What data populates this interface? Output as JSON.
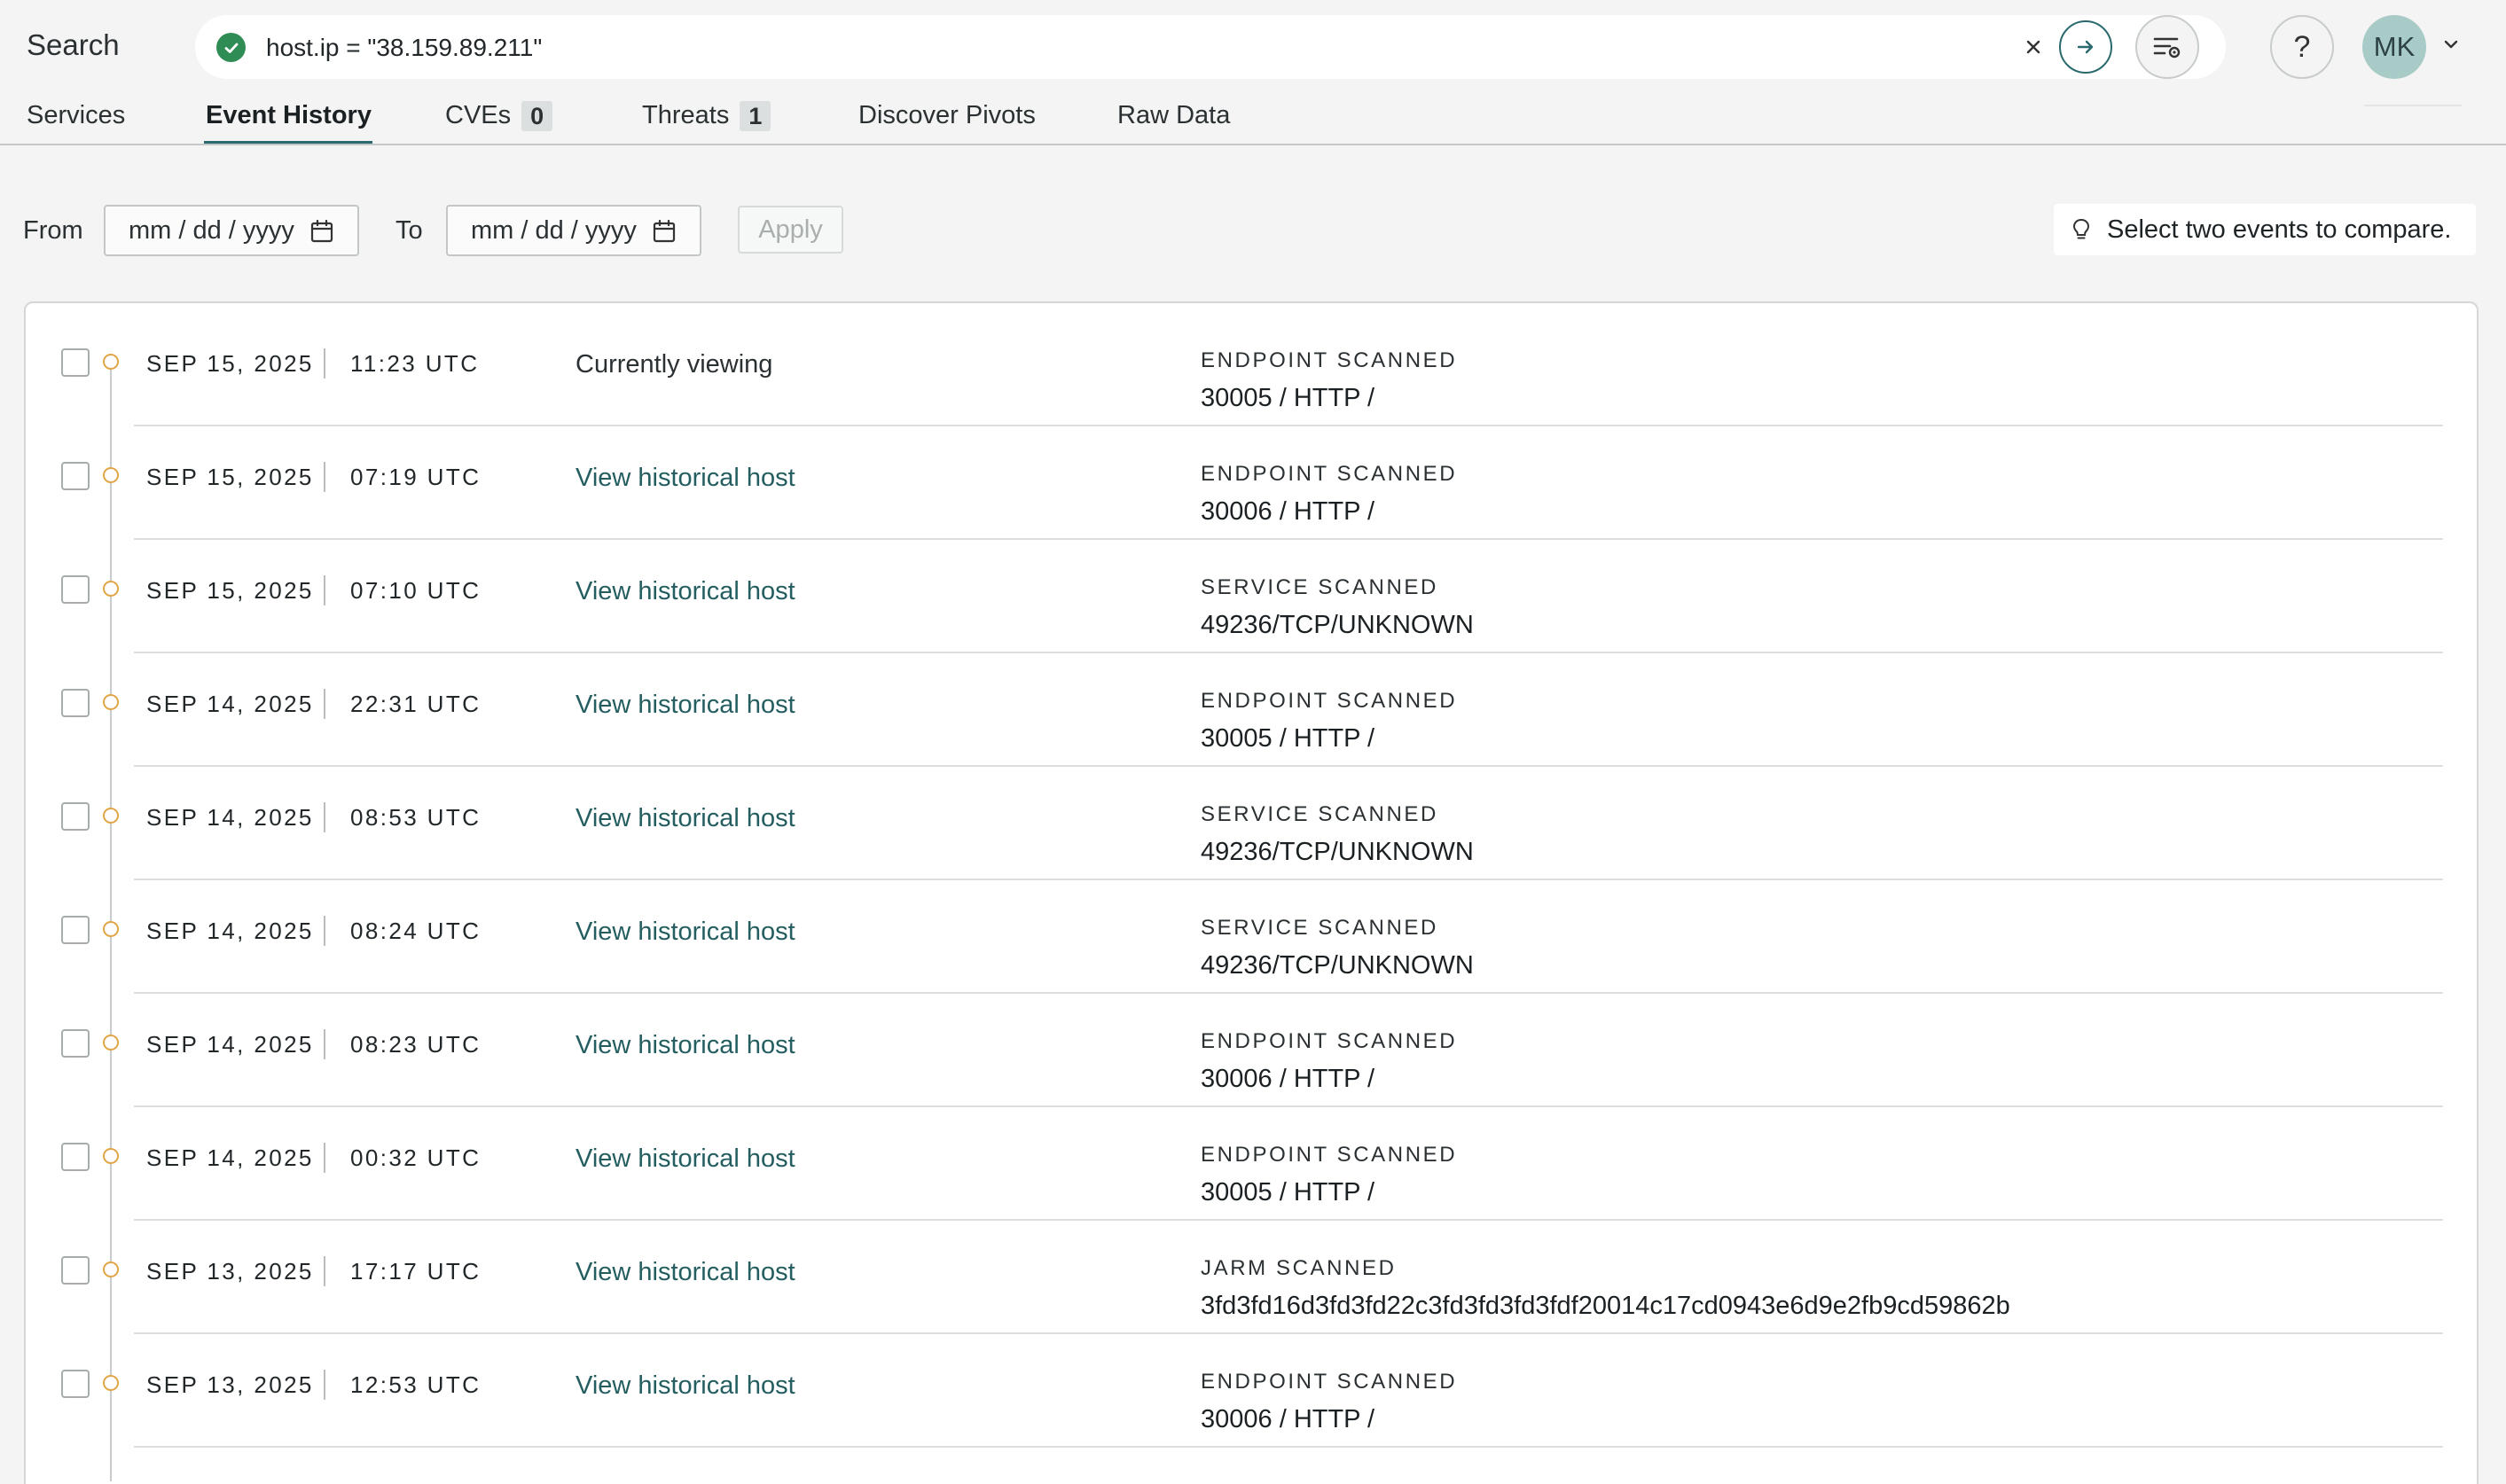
{
  "header": {
    "search_label": "Search",
    "query": "host.ip = \"38.159.89.211\"",
    "avatar_initials": "MK",
    "help_label": "?"
  },
  "tabs": [
    {
      "label": "Services",
      "badge": null
    },
    {
      "label": "Event History",
      "badge": null,
      "active": true
    },
    {
      "label": "CVEs",
      "badge": "0"
    },
    {
      "label": "Threats",
      "badge": "1"
    },
    {
      "label": "Discover Pivots",
      "badge": null
    },
    {
      "label": "Raw Data",
      "badge": null
    }
  ],
  "filters": {
    "from_label": "From",
    "to_label": "To",
    "from_placeholder": "mm / dd / yyyy",
    "to_placeholder": "mm / dd / yyyy",
    "apply_label": "Apply",
    "compare_hint": "Select two events to compare."
  },
  "events": [
    {
      "date": "SEP 15, 2025",
      "time": "11:23 UTC",
      "link": "Currently viewing",
      "current": true,
      "type": "ENDPOINT SCANNED",
      "value": "30005 / HTTP /"
    },
    {
      "date": "SEP 15, 2025",
      "time": "07:19 UTC",
      "link": "View historical host",
      "current": false,
      "type": "ENDPOINT SCANNED",
      "value": "30006 / HTTP /"
    },
    {
      "date": "SEP 15, 2025",
      "time": "07:10 UTC",
      "link": "View historical host",
      "current": false,
      "type": "SERVICE SCANNED",
      "value": "49236/TCP/UNKNOWN"
    },
    {
      "date": "SEP 14, 2025",
      "time": "22:31 UTC",
      "link": "View historical host",
      "current": false,
      "type": "ENDPOINT SCANNED",
      "value": "30005 / HTTP /"
    },
    {
      "date": "SEP 14, 2025",
      "time": "08:53 UTC",
      "link": "View historical host",
      "current": false,
      "type": "SERVICE SCANNED",
      "value": "49236/TCP/UNKNOWN"
    },
    {
      "date": "SEP 14, 2025",
      "time": "08:24 UTC",
      "link": "View historical host",
      "current": false,
      "type": "SERVICE SCANNED",
      "value": "49236/TCP/UNKNOWN"
    },
    {
      "date": "SEP 14, 2025",
      "time": "08:23 UTC",
      "link": "View historical host",
      "current": false,
      "type": "ENDPOINT SCANNED",
      "value": "30006 / HTTP /"
    },
    {
      "date": "SEP 14, 2025",
      "time": "00:32 UTC",
      "link": "View historical host",
      "current": false,
      "type": "ENDPOINT SCANNED",
      "value": "30005 / HTTP /"
    },
    {
      "date": "SEP 13, 2025",
      "time": "17:17 UTC",
      "link": "View historical host",
      "current": false,
      "type": "JARM SCANNED",
      "value": "3fd3fd16d3fd3fd22c3fd3fd3fd3fdf20014c17cd0943e6d9e2fb9cd59862b"
    },
    {
      "date": "SEP 13, 2025",
      "time": "12:53 UTC",
      "link": "View historical host",
      "current": false,
      "type": "ENDPOINT SCANNED",
      "value": "30006 / HTTP /"
    }
  ],
  "colors": {
    "accent": "#2a6a6e",
    "success": "#2f8c54",
    "timeline_dot": "#e3a545",
    "link": "#245e60"
  }
}
